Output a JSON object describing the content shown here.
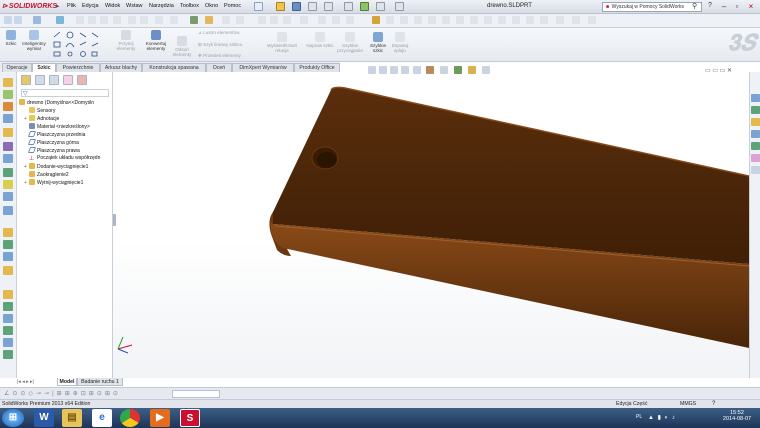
{
  "app": {
    "logo": "SOLIDWORKS",
    "document_title": "drewno.SLDPRT",
    "help_search_placeholder": "Wyszukaj w Pomocy SolidWorks"
  },
  "menu": [
    "Plik",
    "Edycja",
    "Widok",
    "Wstaw",
    "Narzędzia",
    "Toolbox",
    "Okno",
    "Pomoc"
  ],
  "ribbon": {
    "groups": [
      {
        "label": "Szkic",
        "enabled": true
      },
      {
        "label": "Inteligentny wymiar",
        "enabled": true
      },
      {
        "label": "Przytnij elementy",
        "enabled": false
      },
      {
        "label": "Konwertuj elementy",
        "enabled": true
      },
      {
        "label": "Odsuń elementy",
        "enabled": false
      },
      {
        "label": "Lustro elementów",
        "enabled": false
      },
      {
        "label": "Szyk liniowy szkicu",
        "enabled": false
      },
      {
        "label": "Przenieś elementy",
        "enabled": false
      },
      {
        "label": "Wyświetl/Usuń relacje",
        "enabled": false
      },
      {
        "label": "Napraw szkic",
        "enabled": false
      },
      {
        "label": "Szybkie przyciąganie",
        "enabled": false
      },
      {
        "label": "Szybkie szkic",
        "enabled": true
      },
      {
        "label": "Dopasuj splajn",
        "enabled": false
      }
    ]
  },
  "command_tabs": [
    "Operacje",
    "Szkic",
    "Powierzchnie",
    "Arkusz blachy",
    "Konstrukcja spawana",
    "Oceń",
    "DimXpert Wymiarów",
    "Produkty Office"
  ],
  "active_tab": "Szkic",
  "feature_tree": {
    "root": "drewno (Domyślna<<Domyśln",
    "items": [
      {
        "label": "Sensory",
        "expandable": false
      },
      {
        "label": "Adnotacje",
        "expandable": true
      },
      {
        "label": "Materiał <niezkreślony>",
        "expandable": false
      },
      {
        "label": "Płaszczyzna przednia",
        "expandable": false
      },
      {
        "label": "Płaszczyzna górna",
        "expandable": false
      },
      {
        "label": "Płaszczyzna prawa",
        "expandable": false
      },
      {
        "label": "Początek układu współrzędn",
        "expandable": false
      },
      {
        "label": "Dodanie-wyciągnięcie1",
        "expandable": true
      },
      {
        "label": "Zaokrąglenie2",
        "expandable": false
      },
      {
        "label": "Wytnij-wyciągnięcie1",
        "expandable": true
      }
    ]
  },
  "bottom_tabs": [
    "Model",
    "Badanie ruchu 1"
  ],
  "status": {
    "edition": "SolidWorks Premium 2013 x64 Edition",
    "mode": "Edycja Część",
    "units": "MMGS"
  },
  "taskbar": {
    "language": "PL",
    "time": "15:52",
    "date": "2014-08-07"
  },
  "colors": {
    "part_body": "#4a2508",
    "part_highlight": "#7a3f12",
    "accent": "#c8102e"
  }
}
